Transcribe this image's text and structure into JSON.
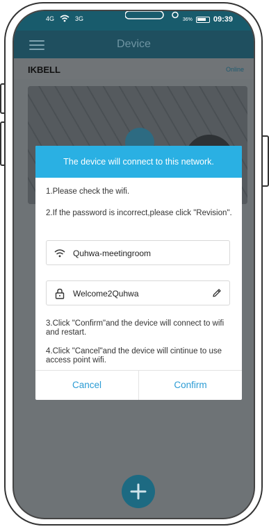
{
  "status_bar": {
    "left": [
      "4G",
      "3G"
    ],
    "right_label": "36%",
    "time": "09:39"
  },
  "header": {
    "title": "Device",
    "menu_icon": "menu-icon"
  },
  "device": {
    "name": "IKBELL",
    "status": "Online"
  },
  "dialog": {
    "title": "The device will connect to this network.",
    "step1": "1.Please check the wifi.",
    "step2": "2.If the password is incorrect,please click \"Revision\".",
    "wifi_name": "Quhwa-meetingroom",
    "password": "Welcome2Quhwa",
    "step3": "3.Click \"Confirm\"and the device will connect to wifi and restart.",
    "step4": "4.Click \"Cancel\"and the device will cintinue to use access point wifi.",
    "cancel_label": "Cancel",
    "confirm_label": "Confirm"
  },
  "colors": {
    "dialog_header": "#2ab0e3",
    "button_text": "#2a9bd4",
    "header_bg": "#1f4f5f",
    "add_button": "#1d6a82"
  },
  "icons": [
    "wifi-icon",
    "lock-icon",
    "pencil-icon",
    "plus-icon",
    "play-icon",
    "menu-icon"
  ]
}
